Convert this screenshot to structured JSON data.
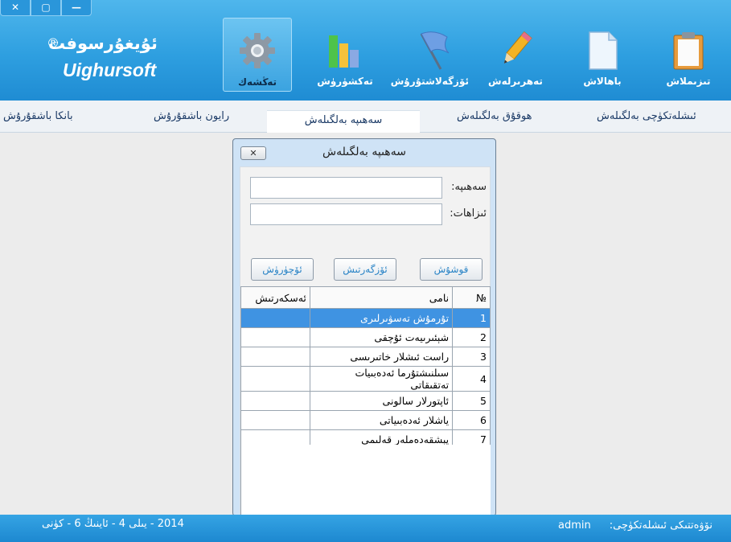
{
  "window_controls": {
    "close": "✕",
    "restore": "▢",
    "minimize": "—"
  },
  "logo": {
    "uyghur": "ئۇيغۇرسوفت",
    "registered": "®",
    "english": "Uighursoft"
  },
  "toolbar": [
    {
      "label": "تەڭشەك",
      "icon": "gear-icon",
      "active": true
    },
    {
      "label": "تەكشۈرۈش",
      "icon": "bar-chart-icon",
      "active": false
    },
    {
      "label": "ئۆزگەلاشتۇرۇش",
      "icon": "flag-icon",
      "active": false
    },
    {
      "label": "تەھرىرلەش",
      "icon": "pencil-icon",
      "active": false
    },
    {
      "label": "باھالاش",
      "icon": "document-icon",
      "active": false
    },
    {
      "label": "تىزىملاش",
      "icon": "clipboard-icon",
      "active": false
    }
  ],
  "tabs": [
    {
      "label": "بانكا باشقۇرۇش"
    },
    {
      "label": "رايون باشقۇرۇش"
    },
    {
      "label": "سەھىپە بەلگىلەش",
      "active": true
    },
    {
      "label": "ھوقۇق بەلگىلەش"
    },
    {
      "label": "ئىشلەتكۈچى بەلگىلەش"
    }
  ],
  "dialog": {
    "title": "سەھىپە بەلگىلەش",
    "close_label": "✕",
    "field1_label": "سەھىپە:",
    "field1_value": "",
    "field2_label": "ئىزاھات:",
    "field2_value": "",
    "btn_delete": "ئۆچۈرۈش",
    "btn_modify": "ئۆزگەرتىش",
    "btn_add": "قوشۇش",
    "columns": {
      "no": "№",
      "name": "نامى",
      "op": "ئەسكەرتىش"
    },
    "rows": [
      {
        "no": "1",
        "name": "تۇرمۇش تەسۋىرلىرى",
        "op": "",
        "selected": true
      },
      {
        "no": "2",
        "name": "شېئىرىيەت ئۇچقى",
        "op": ""
      },
      {
        "no": "3",
        "name": "راست ئىشلار خاتىرىسى",
        "op": ""
      },
      {
        "no": "4",
        "name": "سىلنىشتۇرما ئەدەبىيات تەتقىقاتى",
        "op": ""
      },
      {
        "no": "5",
        "name": "ئاپتورلار سالونى",
        "op": ""
      },
      {
        "no": "6",
        "name": "ياشلار ئەدەبىياتى",
        "op": ""
      },
      {
        "no": "7",
        "name": "پېشقەدەملەر قەلىمى",
        "op": ""
      }
    ]
  },
  "footer": {
    "date": "2014 - يىلى 4 - ئاينىڭ 6 - كۈنى",
    "user_label": "نۆۋەتتىكى ئىشلەتكۈچى:",
    "user": "admin"
  },
  "colors": {
    "header": "#2e9fe0",
    "selection": "#3f93e2",
    "footer": "#1d88d0"
  }
}
